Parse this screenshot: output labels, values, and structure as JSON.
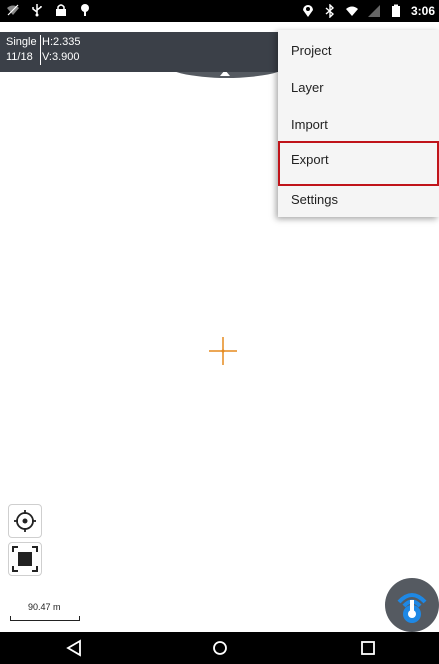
{
  "status_bar": {
    "time": "3:06",
    "left_icons": [
      "wifi-off-icon",
      "usb-icon",
      "lock-icon",
      "location-pin-icon"
    ],
    "right_icons": [
      "location-icon",
      "bluetooth-icon",
      "wifi-icon",
      "signal-icon",
      "battery-icon"
    ]
  },
  "gnss": {
    "mode": "Single",
    "satellites": "11/18",
    "h_label": "H:2.335",
    "v_label": "V:3.900"
  },
  "menu": {
    "items": [
      {
        "label": "Project"
      },
      {
        "label": "Layer"
      },
      {
        "label": "Import"
      },
      {
        "label": "Export"
      },
      {
        "label": "Settings"
      }
    ],
    "highlighted": "Export",
    "highlight_color": "#c0141a"
  },
  "map": {
    "crosshair_color": "#e58a1f",
    "scale_label": "90.47 m"
  },
  "colors": {
    "info_box_bg": "#3b4048",
    "fab_accent": "#1e88e5"
  }
}
